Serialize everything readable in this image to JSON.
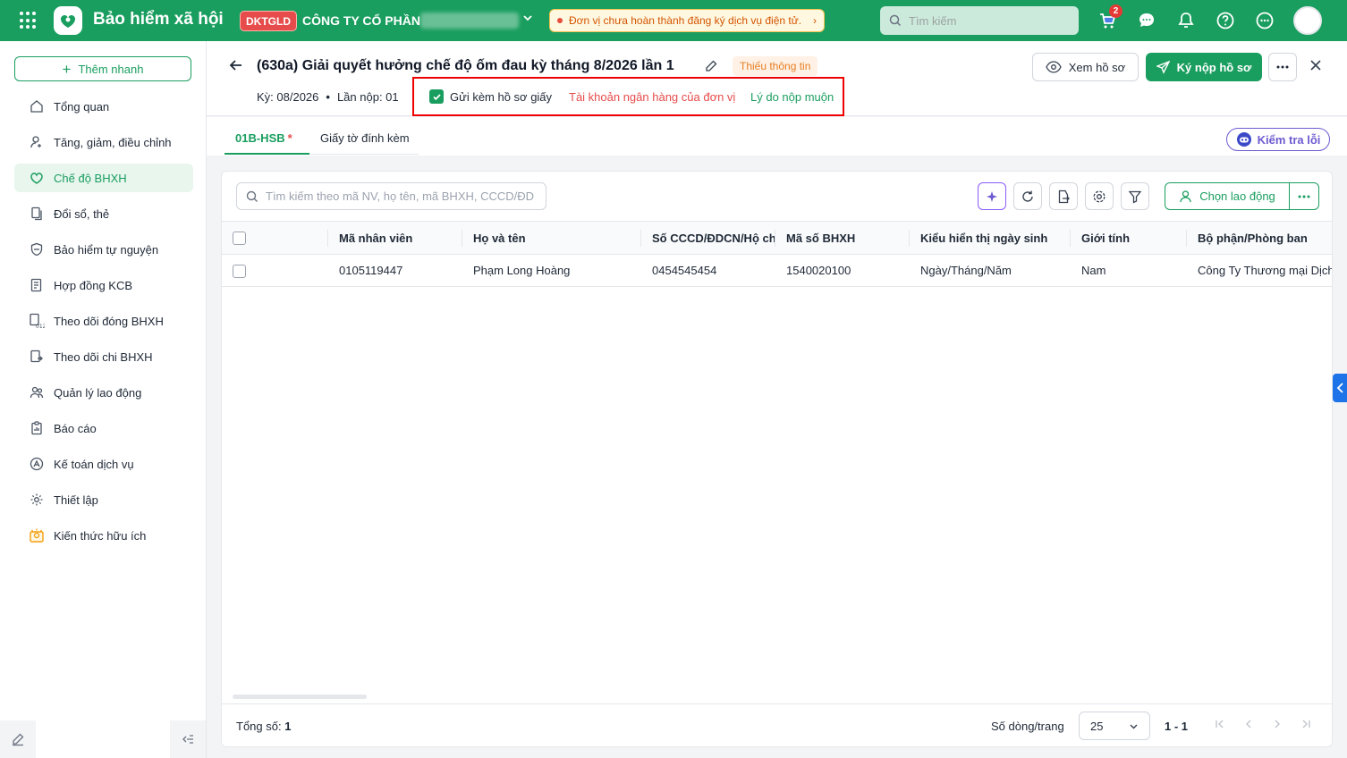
{
  "topbar": {
    "app_title": "Bảo hiểm xã hội",
    "company_code": "DKTGLD",
    "company_name": "CÔNG TY CỔ PHẦN",
    "alert_text": "Đơn vị chưa hoàn thành đăng ký dịch vụ điện tử.",
    "search_placeholder": "Tìm kiếm",
    "cart_badge": "2",
    "brand_color": "#1a9e5f"
  },
  "sidebar": {
    "quick_add_label": "Thêm nhanh",
    "items": [
      {
        "label": "Tổng quan",
        "icon": "home-icon"
      },
      {
        "label": "Tăng, giảm, điều chỉnh",
        "icon": "user-adjust-icon"
      },
      {
        "label": "Chế độ BHXH",
        "icon": "heart-shield-icon",
        "active": true
      },
      {
        "label": "Đổi sổ, thẻ",
        "icon": "cards-icon"
      },
      {
        "label": "Bảo hiểm tự nguyện",
        "icon": "shield-icon"
      },
      {
        "label": "Hợp đồng KCB",
        "icon": "contract-icon"
      },
      {
        "label": "Theo dõi đóng BHXH",
        "icon": "payment-track-icon"
      },
      {
        "label": "Theo dõi chi BHXH",
        "icon": "expense-track-icon"
      },
      {
        "label": "Quản lý lao động",
        "icon": "people-icon"
      },
      {
        "label": "Báo cáo",
        "icon": "report-icon"
      },
      {
        "label": "Kế toán dịch vụ",
        "icon": "accounting-icon"
      },
      {
        "label": "Thiết lập",
        "icon": "gear-icon"
      },
      {
        "label": "Kiến thức hữu ích",
        "icon": "knowledge-icon"
      }
    ]
  },
  "header": {
    "title": "(630a) Giải quyết hưởng chế độ ốm đau kỳ tháng 8/2026 lần 1",
    "status": "Thiếu thông tin",
    "period": "Kỳ: 08/2026",
    "submission": "Lần nộp: 01",
    "paper_checkbox_label": "Gửi kèm hồ sơ giấy",
    "paper_checked": true,
    "bank_account_link": "Tài khoản ngân hàng của đơn vị",
    "late_reason_link": "Lý do nộp muộn",
    "view_button": "Xem hồ sơ",
    "sign_button": "Ký nộp hồ sơ"
  },
  "tabs": [
    {
      "label": "01B-HSB",
      "required": "*",
      "active": true
    },
    {
      "label": "Giấy tờ đính kèm",
      "active": false
    }
  ],
  "check_errors_label": "Kiểm tra lỗi",
  "table": {
    "search_placeholder": "Tìm kiếm theo mã NV, họ tên, mã BHXH, CCCD/ĐD",
    "choose_employee_label": "Chọn lao động",
    "columns": [
      "Mã nhân viên",
      "Họ và tên",
      "Số CCCD/ĐDCN/Hộ chiếu",
      "Mã số BHXH",
      "Kiểu hiển thị ngày sinh",
      "Giới tính",
      "Bộ phận/Phòng ban"
    ],
    "rows": [
      [
        "0105119447",
        "Phạm Long Hoàng",
        "0454545454",
        "1540020100",
        "Ngày/Tháng/Năm",
        "Nam",
        "Công Ty Thương mại Dịch"
      ]
    ]
  },
  "footer": {
    "total_label": "Tổng số:",
    "total_value": "1",
    "rows_per_page_label": "Số dòng/trang",
    "rows_per_page": "25",
    "range": "1 - 1"
  }
}
